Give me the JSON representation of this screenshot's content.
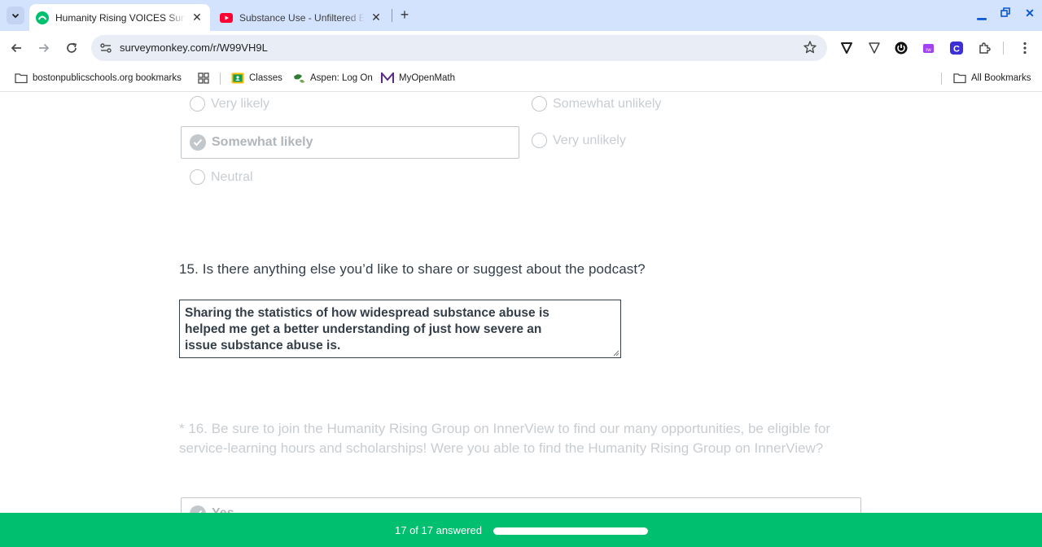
{
  "browser": {
    "tabs": [
      {
        "title": "Humanity Rising VOICES Surve",
        "active": true
      },
      {
        "title": "Substance Use - Unfiltered Emo",
        "active": false
      }
    ],
    "new_tab_label": "+",
    "url": "surveymonkey.com/r/W99VH9L",
    "bookmarks": {
      "folder": "bostonpublicschools.org bookmarks",
      "classes": "Classes",
      "aspen": "Aspen: Log On",
      "myopenmath": "MyOpenMath",
      "all": "All Bookmarks"
    },
    "colors": {
      "tabbar": "#d3e3fd",
      "accent": "#0b57d0"
    }
  },
  "survey": {
    "previous_options": {
      "very_likely": "Very likely",
      "somewhat_likely": "Somewhat likely",
      "neutral": "Neutral",
      "somewhat_unlikely": "Somewhat unlikely",
      "very_unlikely": "Very unlikely",
      "selected": "Somewhat likely"
    },
    "q15": {
      "text": "15. Is there anything else you’d like to share or suggest about the podcast?",
      "answer": "Sharing the statistics of how widespread substance abuse is helped me get a better understanding of just how severe an issue substance abuse is."
    },
    "q16": {
      "text": "* 16. Be sure to join the Humanity Rising Group on InnerView to find our many opportunities, be eligible for service-learning hours and scholarships! Were you able to find the Humanity Rising Group on InnerView?",
      "selected_option": "Yes"
    }
  },
  "progress": {
    "label": "17 of 17 answered",
    "fraction": 1.0,
    "color": "#00bf6f"
  }
}
